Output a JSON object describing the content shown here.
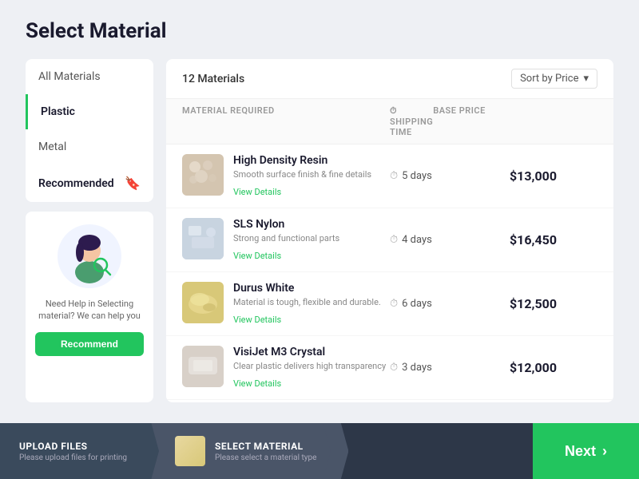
{
  "page": {
    "title": "Select Material"
  },
  "sidebar": {
    "menu_items": [
      {
        "label": "All Materials",
        "active": false
      },
      {
        "label": "Plastic",
        "active": true
      },
      {
        "label": "Metal",
        "active": false
      },
      {
        "label": "Recommended",
        "active": false,
        "has_bookmark": true
      }
    ],
    "help_card": {
      "help_text": "Need Help in Selecting material? We can help you",
      "button_label": "Recommend"
    }
  },
  "materials_panel": {
    "count_label": "12 Materials",
    "sort_label": "Sort by Price",
    "table_headers": {
      "material": "MATERIAL REQUIRED",
      "shipping": "SHIPPING TIME",
      "price": "BASE PRICE"
    },
    "materials": [
      {
        "name": "High Density Resin",
        "description": "Smooth surface finish & fine details",
        "shipping_days": "5 days",
        "price": "$13,000",
        "view_details": "View Details",
        "thumb_class": "thumb-resin"
      },
      {
        "name": "SLS Nylon",
        "description": "Strong and functional parts",
        "shipping_days": "4 days",
        "price": "$16,450",
        "view_details": "View Details",
        "thumb_class": "thumb-nylon"
      },
      {
        "name": "Durus White",
        "description": "Material is tough, flexible and durable.",
        "shipping_days": "6 days",
        "price": "$12,500",
        "view_details": "View Details",
        "thumb_class": "thumb-durus"
      },
      {
        "name": "VisiJet M3 Crystal",
        "description": "Clear plastic delivers high transparency",
        "shipping_days": "3 days",
        "price": "$12,000",
        "view_details": "View Details",
        "thumb_class": "thumb-visijet"
      }
    ]
  },
  "bottom_bar": {
    "step1": {
      "title": "UPLOAD FILES",
      "subtitle": "Please upload files for printing"
    },
    "step2": {
      "title": "SELECT MATERIAL",
      "subtitle": "Please select a material type"
    },
    "next_label": "Next"
  }
}
